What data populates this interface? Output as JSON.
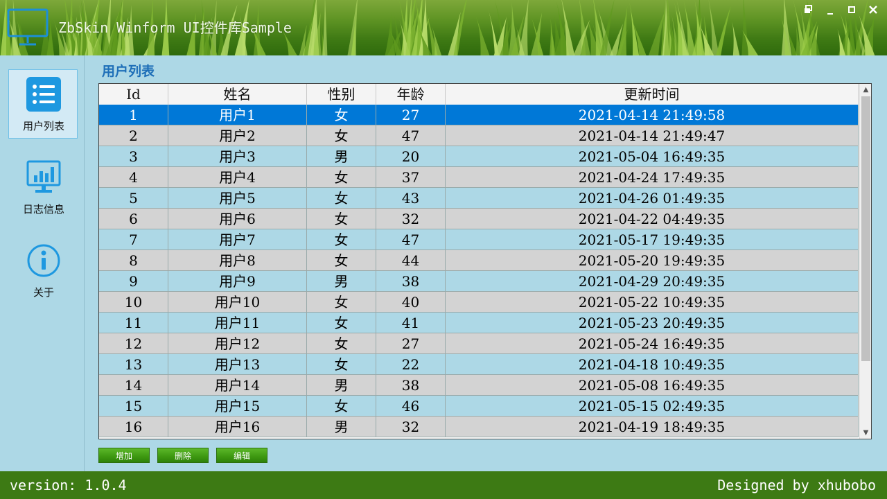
{
  "app": {
    "title": "ZbSkin Winform UI控件库Sample"
  },
  "window_controls": [
    "restore-icon",
    "minimize-icon",
    "maximize-icon",
    "close-icon"
  ],
  "sidebar": {
    "items": [
      {
        "label": "用户列表",
        "icon": "list-icon",
        "active": true
      },
      {
        "label": "日志信息",
        "icon": "bar-chart-monitor-icon",
        "active": false
      },
      {
        "label": "关于",
        "icon": "info-icon",
        "active": false
      }
    ]
  },
  "main": {
    "title": "用户列表",
    "columns": [
      "Id",
      "姓名",
      "性别",
      "年龄",
      "更新时间"
    ],
    "rows": [
      [
        "1",
        "用户1",
        "女",
        "27",
        "2021-04-14 21:49:58"
      ],
      [
        "2",
        "用户2",
        "女",
        "47",
        "2021-04-14 21:49:47"
      ],
      [
        "3",
        "用户3",
        "男",
        "20",
        "2021-05-04 16:49:35"
      ],
      [
        "4",
        "用户4",
        "女",
        "37",
        "2021-04-24 17:49:35"
      ],
      [
        "5",
        "用户5",
        "女",
        "43",
        "2021-04-26 01:49:35"
      ],
      [
        "6",
        "用户6",
        "女",
        "32",
        "2021-04-22 04:49:35"
      ],
      [
        "7",
        "用户7",
        "女",
        "47",
        "2021-05-17 19:49:35"
      ],
      [
        "8",
        "用户8",
        "女",
        "44",
        "2021-05-20 19:49:35"
      ],
      [
        "9",
        "用户9",
        "男",
        "38",
        "2021-04-29 20:49:35"
      ],
      [
        "10",
        "用户10",
        "女",
        "40",
        "2021-05-22 10:49:35"
      ],
      [
        "11",
        "用户11",
        "女",
        "41",
        "2021-05-23 20:49:35"
      ],
      [
        "12",
        "用户12",
        "女",
        "27",
        "2021-05-24 16:49:35"
      ],
      [
        "13",
        "用户13",
        "女",
        "22",
        "2021-04-18 10:49:35"
      ],
      [
        "14",
        "用户14",
        "男",
        "38",
        "2021-05-08 16:49:35"
      ],
      [
        "15",
        "用户15",
        "女",
        "46",
        "2021-05-15 02:49:35"
      ],
      [
        "16",
        "用户16",
        "男",
        "32",
        "2021-04-19 18:49:35"
      ]
    ],
    "selected_row": 0,
    "buttons": {
      "add": "增加",
      "delete": "删除",
      "edit": "编辑"
    }
  },
  "footer": {
    "version": "version: 1.0.4",
    "designer": "Designed by xhubobo"
  },
  "colors": {
    "accent": "#0078d7",
    "title_blue": "#1e6fb8",
    "row_odd": "#add8e6",
    "row_even": "#d3d3d3",
    "footer_green": "#3d7a14",
    "button_green": "#3f9a12"
  }
}
